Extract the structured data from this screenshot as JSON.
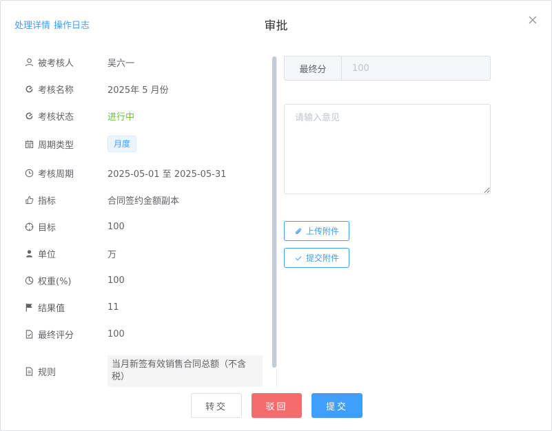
{
  "header": {
    "link_details": "处理详情",
    "link_log": "操作日志",
    "title": "审批"
  },
  "icons": {
    "close": "close-icon"
  },
  "details": [
    {
      "icon": "user-icon",
      "label": "被考核人",
      "value": "吴六一"
    },
    {
      "icon": "refresh-icon",
      "label": "考核名称",
      "value": "2025年 5 月份"
    },
    {
      "icon": "refresh-icon",
      "label": "考核状态",
      "value": "进行中",
      "color": "#67c23a"
    },
    {
      "icon": "calendar-icon",
      "label": "周期类型",
      "value": "月度"
    },
    {
      "icon": "clock-icon",
      "label": "考核周期",
      "value": "2025-05-01 至 2025-05-31"
    },
    {
      "icon": "thumb-icon",
      "label": "指标",
      "value": "合同签约金额副本"
    },
    {
      "icon": "target-icon",
      "label": "目标",
      "value": "100"
    },
    {
      "icon": "person-filled-icon",
      "label": "单位",
      "value": "万"
    },
    {
      "icon": "pie-icon",
      "label": "权重(%)",
      "value": "100"
    },
    {
      "icon": "flag-icon",
      "label": "结果值",
      "value": "11"
    },
    {
      "icon": "doc-check-icon",
      "label": "最终评分",
      "value": "100"
    },
    {
      "icon": "document-icon",
      "label": "规则",
      "value": "当月新签有效销售合同总额（不含税）"
    }
  ],
  "form": {
    "final_score_label": "最终分",
    "final_score_value": "100",
    "opinion_placeholder": "请输入意见",
    "upload_label": "上传附件",
    "submit_attach_label": "提交附件"
  },
  "footer": {
    "transfer": "转交",
    "reject": "驳回",
    "submit": "提交"
  },
  "colors": {
    "primary": "#409eff",
    "danger": "#f56c6c",
    "success": "#67c23a"
  }
}
